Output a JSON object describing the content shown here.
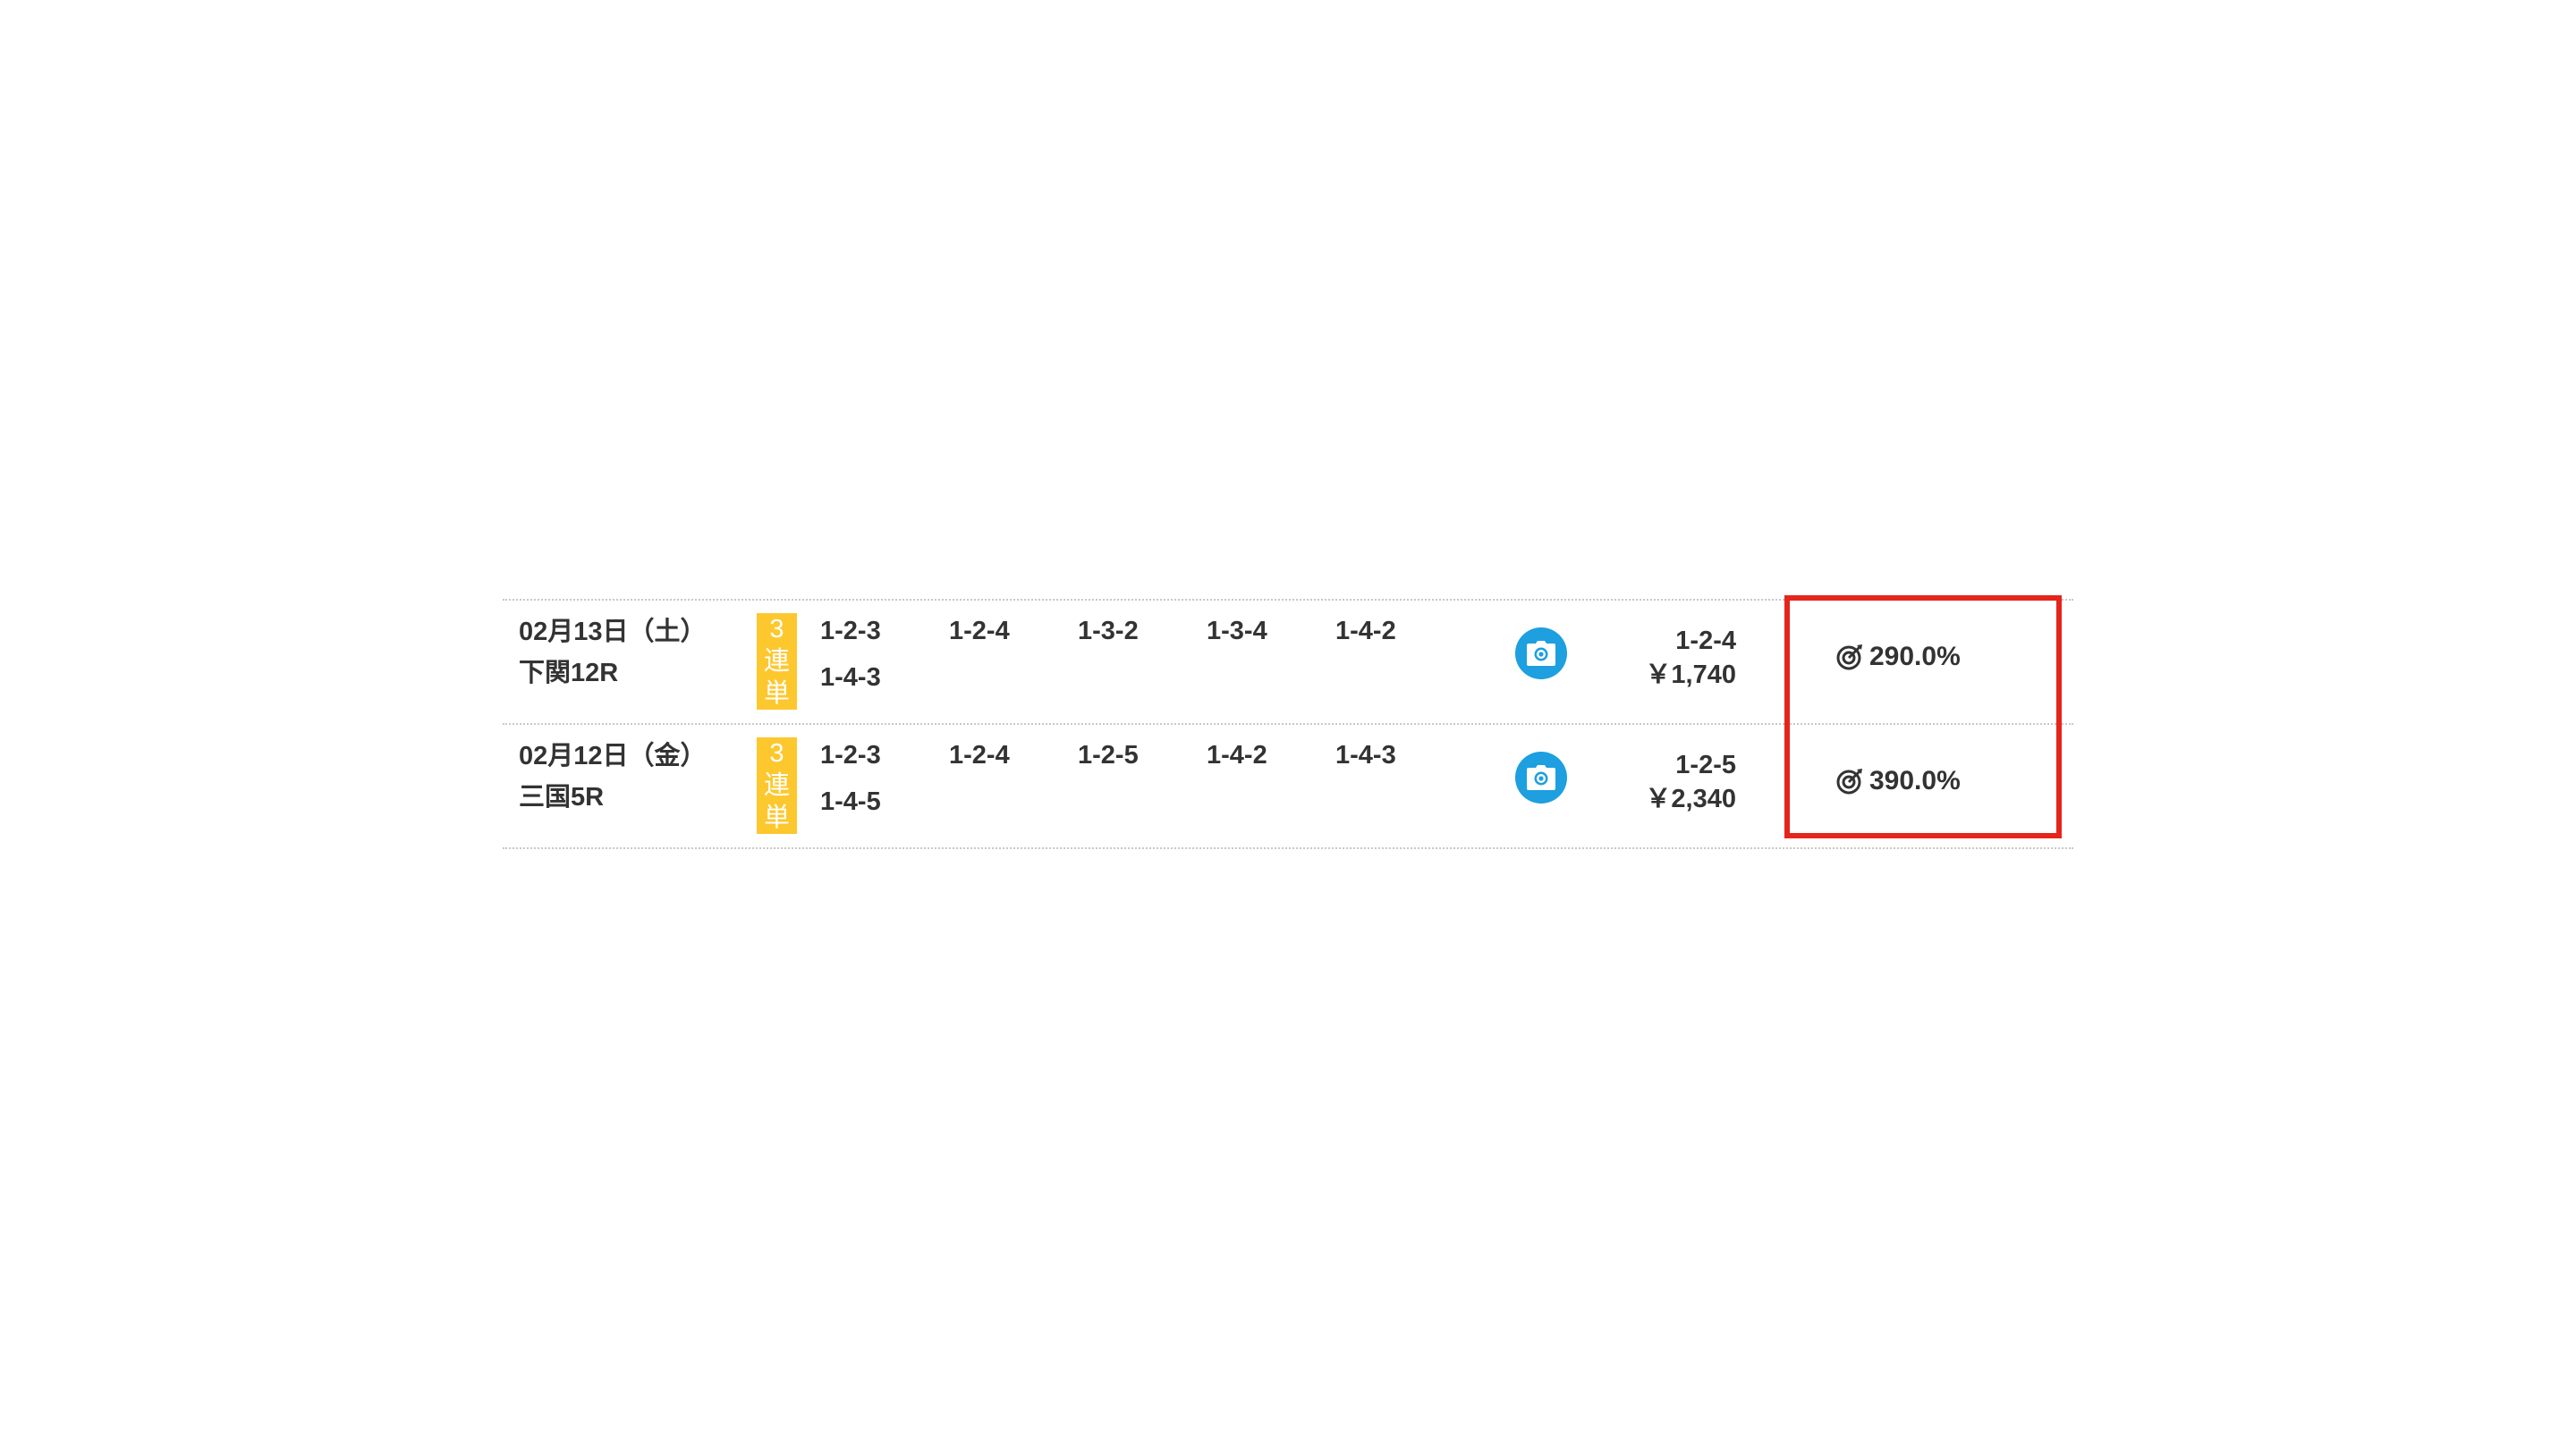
{
  "rows": [
    {
      "date": "02月13日（土）",
      "venue": "下関12R",
      "bet_type": [
        "3",
        "連",
        "単"
      ],
      "combos": [
        "1-2-3",
        "1-2-4",
        "1-3-2",
        "1-3-4",
        "1-4-2",
        "1-4-3"
      ],
      "result_combo": "1-2-4",
      "payout": "￥1,740",
      "recovery": "290.0%"
    },
    {
      "date": "02月12日（金）",
      "venue": "三国5R",
      "bet_type": [
        "3",
        "連",
        "単"
      ],
      "combos": [
        "1-2-3",
        "1-2-4",
        "1-2-5",
        "1-4-2",
        "1-4-3",
        "1-4-5"
      ],
      "result_combo": "1-2-5",
      "payout": "￥2,340",
      "recovery": "390.0%"
    }
  ],
  "icons": {
    "camera": "camera-icon",
    "target": "target-icon"
  },
  "colors": {
    "badge": "#fdc72e",
    "camera_button": "#1d9fe0",
    "highlight": "#e5251b",
    "text": "#333333"
  }
}
